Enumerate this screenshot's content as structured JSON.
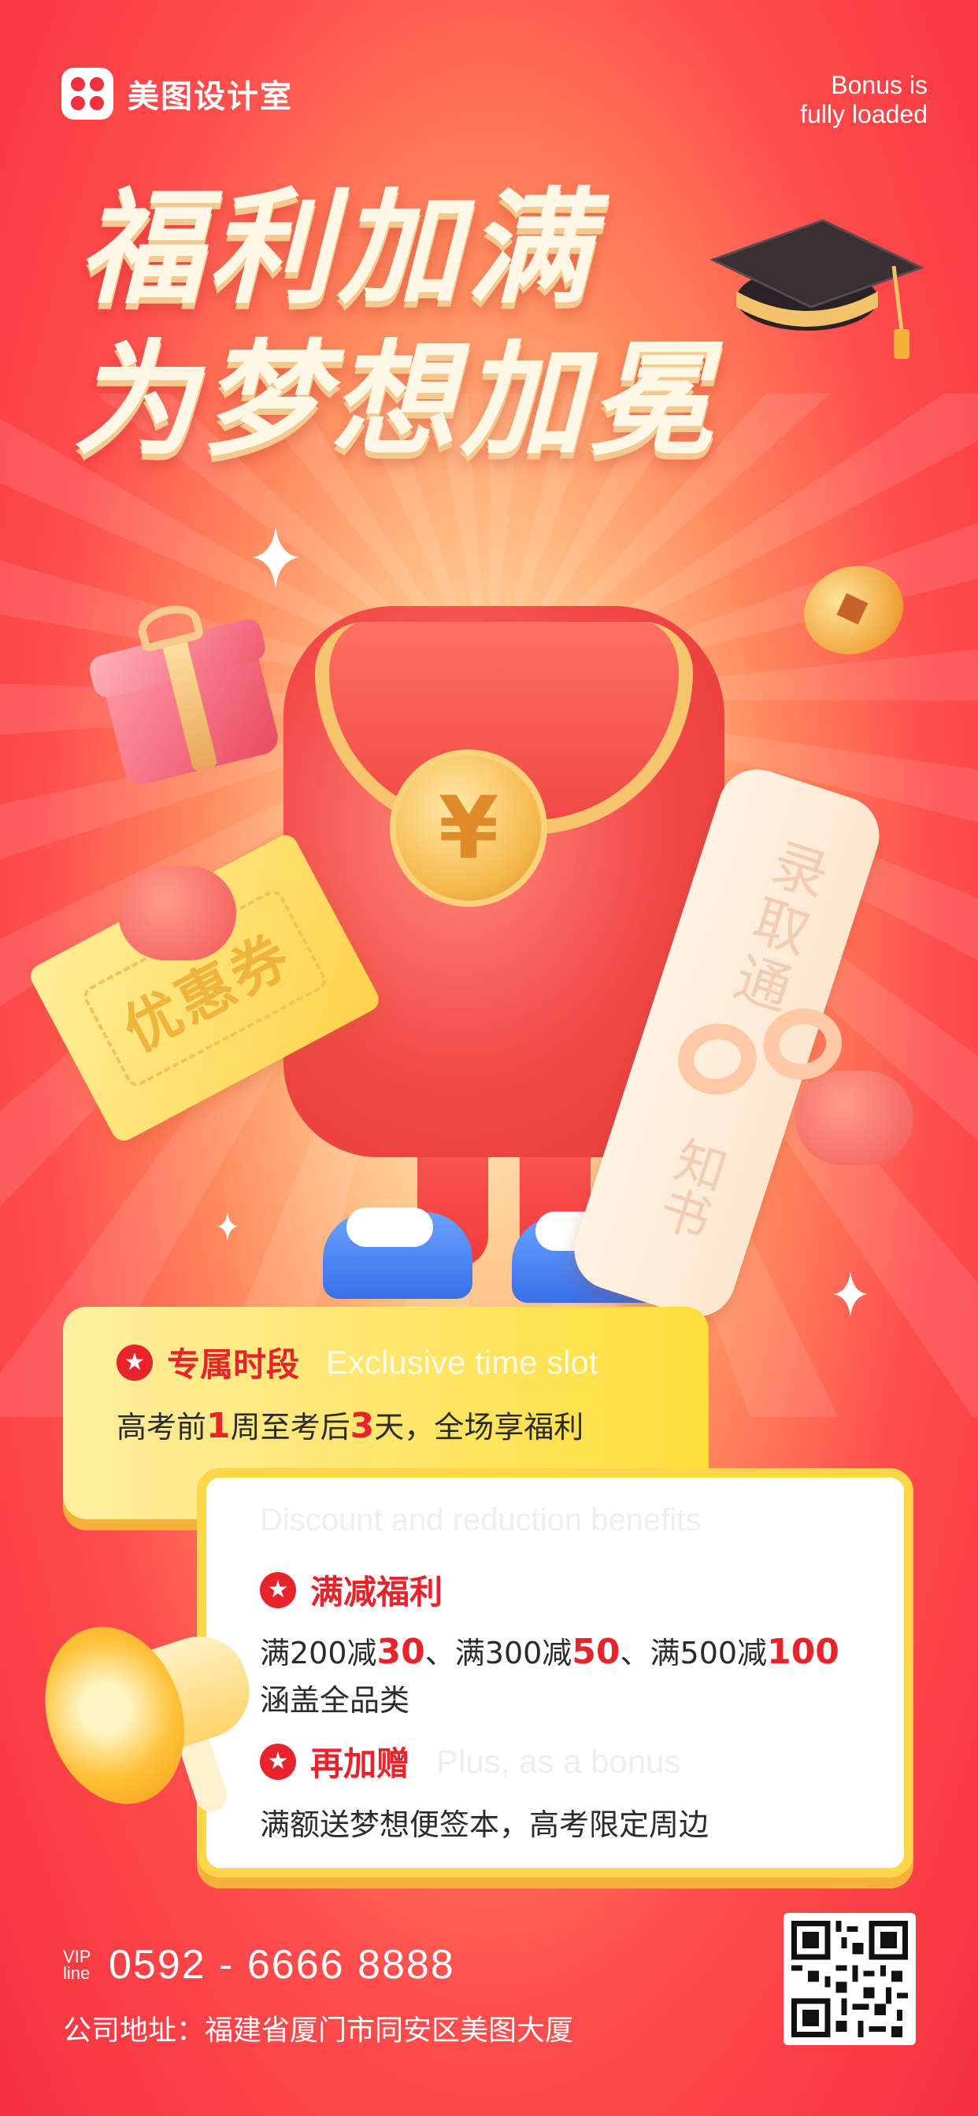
{
  "brand": {
    "logo_text": "美图设计室"
  },
  "corner_tag": {
    "line1": "Bonus is",
    "line2": "fully loaded"
  },
  "headline": {
    "line1": "福利加满",
    "line2": "为梦想加冕"
  },
  "illustration": {
    "coupon_text": "优惠券",
    "coin_symbol": "¥",
    "scroll_text_top": "录取通",
    "scroll_text_bottom": "知书"
  },
  "card1": {
    "title": "专属时段",
    "title_en": "Exclusive time slot",
    "line_pre": "高考前",
    "num1": "1",
    "line_mid": "周至考后",
    "num2": "3",
    "line_post": "天，全场享福利"
  },
  "card2": {
    "header_en": "Discount and reduction benefits",
    "section1": {
      "title": "满减福利",
      "t1": "满200减",
      "v1": "30",
      "t2": "、满300减",
      "v2": "50",
      "t3": "、满500减",
      "v3": "100",
      "line2": "涵盖全品类"
    },
    "section2": {
      "title": "再加赠",
      "title_en": "Plus, as a bonus",
      "line": "满额送梦想便签本，高考限定周边"
    }
  },
  "footer": {
    "vip_label_1": "VIP",
    "vip_label_2": "line",
    "phone": "0592 - 6666 8888",
    "address": "公司地址：福建省厦门市同安区美图大厦"
  },
  "colors": {
    "accent_red": "#e8232b",
    "card_yellow": "#ffde3a",
    "background_red": "#f5303e"
  },
  "icons": [
    "star-badge-icon",
    "qr-code-icon",
    "graduation-cap-icon",
    "megaphone-icon",
    "gift-icon",
    "coin-icon",
    "sparkle-icon"
  ]
}
